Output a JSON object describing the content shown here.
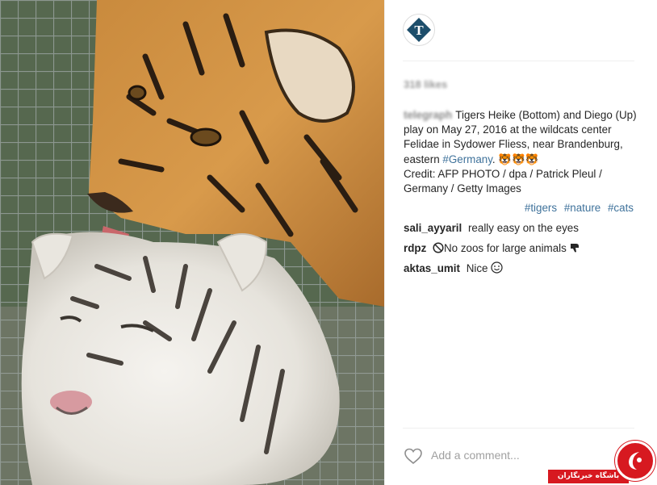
{
  "post": {
    "likes": "318 likes",
    "caption_author": "telegraph",
    "caption_text_1": "Tigers Heike (Bottom) and Diego (Up) play on May 27, 2016 at the wildcats center Felidae in Sydower Fliess, near Brandenburg, eastern ",
    "caption_hashtag": "#Germany",
    "caption_text_2": ". ",
    "caption_emoji": "🐯🐯🐯",
    "caption_credit": "Credit: AFP PHOTO / dpa / Patrick Pleul / Germany / Getty Images",
    "tags": [
      "#tigers",
      "#nature",
      "#cats"
    ]
  },
  "comments": [
    {
      "user": "sali_ayyaril",
      "text": "really easy on the eyes"
    },
    {
      "user": "rdpz",
      "text": "No zoos for large animals"
    },
    {
      "user": "aktas_umit",
      "text": "Nice"
    }
  ],
  "composer": {
    "placeholder": "Add a comment..."
  },
  "watermark": {
    "text": "باشگاه خبرنگاران"
  },
  "icons": {
    "avatar": "telegraph-logo-icon",
    "heart": "heart-icon",
    "no-entry": "prohibited-icon",
    "thumbs-down": "thumbs-down-icon",
    "smile": "smile-icon"
  },
  "colors": {
    "hashtag": "#3f729b",
    "avatar_badge": "#1d4e6b",
    "watermark": "#d71920"
  }
}
